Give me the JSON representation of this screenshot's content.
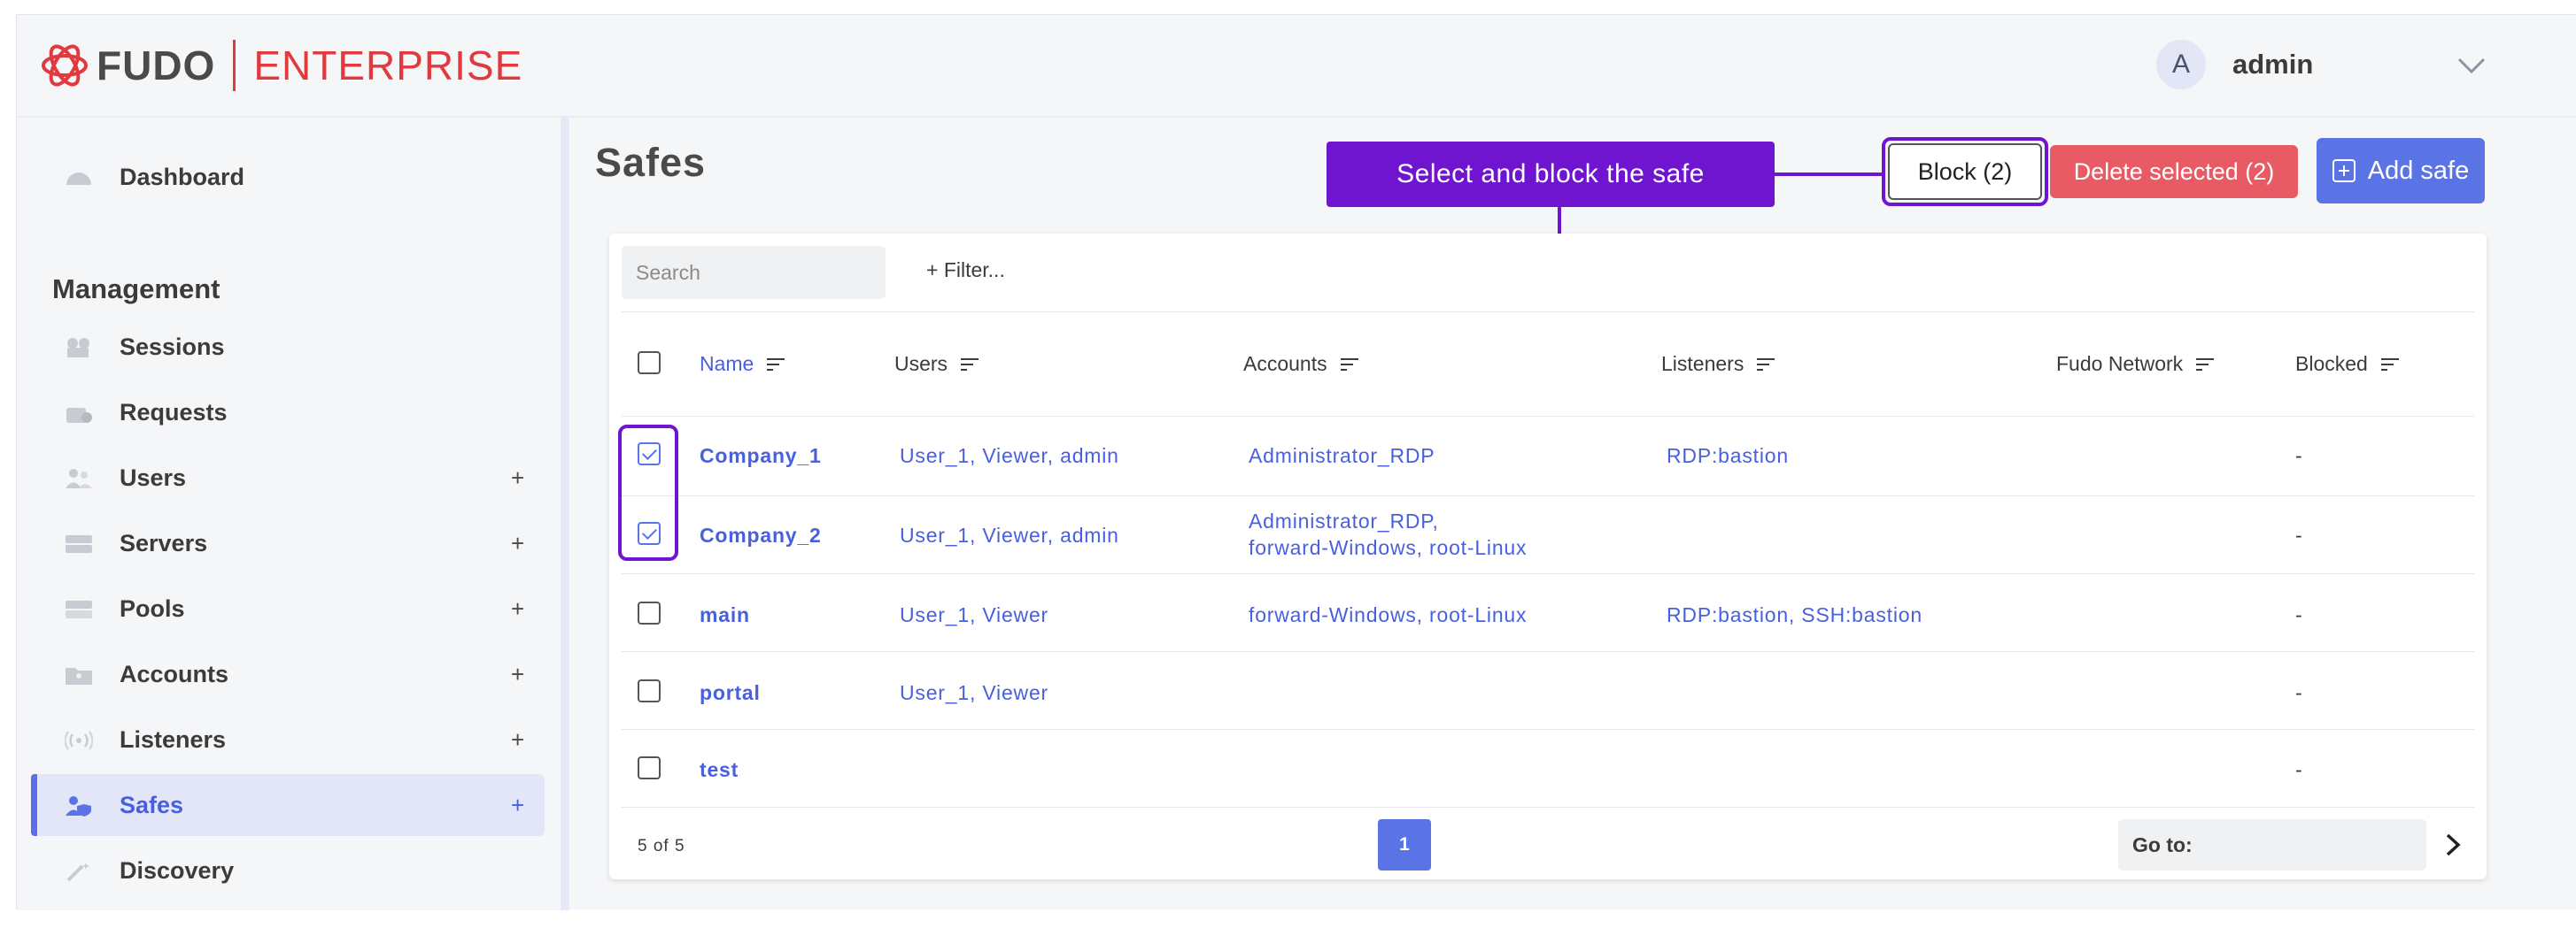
{
  "header": {
    "logo_primary": "FUDO",
    "logo_secondary": "ENTERPRISE",
    "user_initial": "A",
    "user_name": "admin"
  },
  "sidebar": {
    "dashboard": "Dashboard",
    "section_title": "Management",
    "items": [
      {
        "label": "Sessions",
        "icon": "camera-icon",
        "has_add": false
      },
      {
        "label": "Requests",
        "icon": "request-icon",
        "has_add": false
      },
      {
        "label": "Users",
        "icon": "users-icon",
        "has_add": true
      },
      {
        "label": "Servers",
        "icon": "server-icon",
        "has_add": true
      },
      {
        "label": "Pools",
        "icon": "pool-icon",
        "has_add": true
      },
      {
        "label": "Accounts",
        "icon": "account-folder-icon",
        "has_add": true
      },
      {
        "label": "Listeners",
        "icon": "broadcast-icon",
        "has_add": true
      },
      {
        "label": "Safes",
        "icon": "user-shield-icon",
        "has_add": true,
        "active": true
      },
      {
        "label": "Discovery",
        "icon": "wand-icon",
        "has_add": false
      }
    ],
    "add_symbol": "+"
  },
  "main": {
    "title": "Safes",
    "buttons": {
      "block": "Block (2)",
      "delete": "Delete selected (2)",
      "add": "Add safe"
    },
    "callout": "Select and block the safe",
    "search_placeholder": "Search",
    "filter_label": "+ Filter..."
  },
  "table": {
    "columns": [
      "Name",
      "Users",
      "Accounts",
      "Listeners",
      "Fudo Network",
      "Blocked"
    ],
    "rows": [
      {
        "checked": true,
        "name": "Company_1",
        "users": "User_1, Viewer, admin",
        "accounts": [
          "Administrator_RDP"
        ],
        "listeners": "RDP:bastion",
        "fudo_network": "",
        "blocked": "-"
      },
      {
        "checked": true,
        "name": "Company_2",
        "users": "User_1, Viewer, admin",
        "accounts": [
          "Administrator_RDP,",
          "forward-Windows, root-Linux"
        ],
        "listeners": "",
        "fudo_network": "",
        "blocked": "-"
      },
      {
        "checked": false,
        "name": "main",
        "users": "User_1, Viewer",
        "accounts": [
          "forward-Windows, root-Linux"
        ],
        "listeners": "RDP:bastion, SSH:bastion",
        "fudo_network": "",
        "blocked": "-"
      },
      {
        "checked": false,
        "name": "portal",
        "users": "User_1, Viewer",
        "accounts": [],
        "listeners": "",
        "fudo_network": "",
        "blocked": "-"
      },
      {
        "checked": false,
        "name": "test",
        "users": "",
        "accounts": [],
        "listeners": "",
        "fudo_network": "",
        "blocked": "-"
      }
    ]
  },
  "pagination": {
    "info": "5 of 5",
    "current_page": "1",
    "goto_label": "Go to:"
  },
  "colors": {
    "accent": "#5a74e6",
    "annotation": "#6f14cf",
    "danger": "#e85a64",
    "brand_red": "#e03a3e"
  }
}
